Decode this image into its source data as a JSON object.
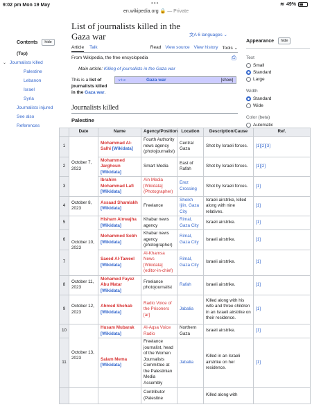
{
  "status": {
    "time": "9:02 pm  Mon 19 May",
    "battery": "49%"
  },
  "address": {
    "url": "en.wikipedia.org",
    "lock": "🔒",
    "private": "— Private"
  },
  "toc": {
    "title": "Contents",
    "hide": "hide",
    "items": [
      {
        "label": "(Top)",
        "cls": "top"
      },
      {
        "label": "Journalists killed",
        "cls": "exp"
      },
      {
        "label": "Palestine",
        "cls": "sub"
      },
      {
        "label": "Lebanon",
        "cls": "sub"
      },
      {
        "label": "Israel",
        "cls": "sub"
      },
      {
        "label": "Syria",
        "cls": "sub"
      },
      {
        "label": "Journalists injured",
        "cls": "lvl1"
      },
      {
        "label": "See also",
        "cls": "lvl1"
      },
      {
        "label": "References",
        "cls": "lvl1"
      }
    ]
  },
  "article": {
    "title": "List of journalists killed in the Gaza war",
    "languages": "6 languages",
    "tab_article": "Article",
    "tab_talk": "Talk",
    "tab_read": "Read",
    "tab_source": "View source",
    "tab_history": "View history",
    "tab_tools": "Tools",
    "from": "From Wikipedia, the free encyclopedia",
    "main_article_prefix": "Main article:",
    "main_article_link": "Killing of journalists in the Gaza war",
    "intro_pre": "This is a ",
    "intro_b1": "list of journalists killed in the ",
    "intro_link": "Gaza war",
    "navbox_vte": "v·t·e",
    "navbox_title": "Gaza war",
    "navbox_show": "[show]",
    "section": "Journalists killed",
    "subsection": "Palestine"
  },
  "appearance": {
    "title": "Appearance",
    "hide": "hide",
    "text_label": "Text",
    "text_opts": [
      "Small",
      "Standard",
      "Large"
    ],
    "text_sel": 1,
    "width_label": "Width",
    "width_opts": [
      "Standard",
      "Wide"
    ],
    "width_sel": 0,
    "color_label": "Color (beta)",
    "color_opts": [
      "Automatic"
    ]
  },
  "table": {
    "headers": [
      "",
      "Date",
      "Name",
      "Agency/Position",
      "Location",
      "Description/Cause",
      "Ref."
    ],
    "rows": [
      {
        "n": "1",
        "date": "",
        "name": "Mohammad Al-Salhi",
        "agency": "Fourth Authority news agency (photojournalist)",
        "agencyLink": false,
        "loc": "Central Gaza",
        "locLink": false,
        "desc": "Shot by Israeli forces.",
        "ref": "[1][2][3]"
      },
      {
        "n": "2",
        "date": "October 7, 2023",
        "name": "Mohammed Jarghoun",
        "agency": "Smart Media",
        "agencyLink": false,
        "loc": "East of Rafah",
        "locLink": false,
        "desc": "Shot by Israeli forces.",
        "ref": "[1][2]"
      },
      {
        "n": "3",
        "date": "",
        "name": "Ibrahim Mohammad Lafi",
        "agency": "Ain Media [Wikidata] (Photographer)",
        "agencyLink": true,
        "loc": "Erez Crossing",
        "locLink": true,
        "desc": "Shot by Israeli forces.",
        "ref": "[1]"
      },
      {
        "n": "4",
        "date": "October 8, 2023",
        "name": "Assaad Shamlakh",
        "agency": "Freelance",
        "agencyLink": false,
        "loc": "Sheikh Ijlin, Gaza City",
        "locLink": true,
        "desc": "Israeli airstrike, killed along with nine relatives.",
        "ref": "[1]"
      },
      {
        "n": "5",
        "date": "",
        "name": "Hisham Alnwajha",
        "agency": "Khabar news agency",
        "agencyLink": false,
        "loc": "Rimal, Gaza City",
        "locLink": true,
        "desc": "Israeli airstrike.",
        "ref": "[1]"
      },
      {
        "n": "6",
        "date": "October 10, 2023",
        "name": "Mohammed Sobh",
        "agency": "Khabar news agency (photographer)",
        "agencyLink": false,
        "loc": "Rimal, Gaza City",
        "locLink": true,
        "desc": "Israeli airstrike.",
        "ref": "[1]"
      },
      {
        "n": "7",
        "date": "",
        "name": "Saeed Al-Taweel",
        "agency": "Al-Khamsa News [Wikidata] (editor-in-chief)",
        "agencyLink": true,
        "loc": "Rimal, Gaza City",
        "locLink": true,
        "desc": "Israeli airstrike.",
        "ref": "[1]"
      },
      {
        "n": "8",
        "date": "October 11, 2023",
        "name": "Mohamed Fayez Abu Matar",
        "agency": "Freelance photojournalist",
        "agencyLink": false,
        "loc": "Rafah",
        "locLink": true,
        "desc": "Israeli airstrike.",
        "ref": "[1]"
      },
      {
        "n": "9",
        "date": "October 12, 2023",
        "name": "Ahmed Shehab",
        "agency": "Radio Voice of the Prisoners [ar]",
        "agencyLink": true,
        "loc": "Jabalia",
        "locLink": true,
        "desc": "Killed along with his wife and three children in an Israeli airstrike on their residence.",
        "ref": "[1]"
      },
      {
        "n": "10",
        "date": "",
        "name": "Husam Mubarak",
        "agency": "Al-Aqsa Voice Radio",
        "agencyLink": true,
        "loc": "Northern Gaza",
        "locLink": false,
        "desc": "Israeli airstrike.",
        "ref": "[1]"
      },
      {
        "n": "11",
        "date": "October 13, 2023",
        "name": "Salam Mema",
        "agency": "Freelance journalist, head of the Women Journalists Committee at the Palestinian Media Assembly",
        "agencyLink": false,
        "loc": "Jabalia",
        "locLink": true,
        "desc": "Killed in an Israeli airstrike on her residence.",
        "ref": "[1]"
      },
      {
        "n": "",
        "date": "",
        "name": "",
        "agency": "Contributor (Palestine",
        "agencyLink": false,
        "loc": "",
        "locLink": false,
        "desc": "Killed along with",
        "ref": ""
      }
    ]
  }
}
